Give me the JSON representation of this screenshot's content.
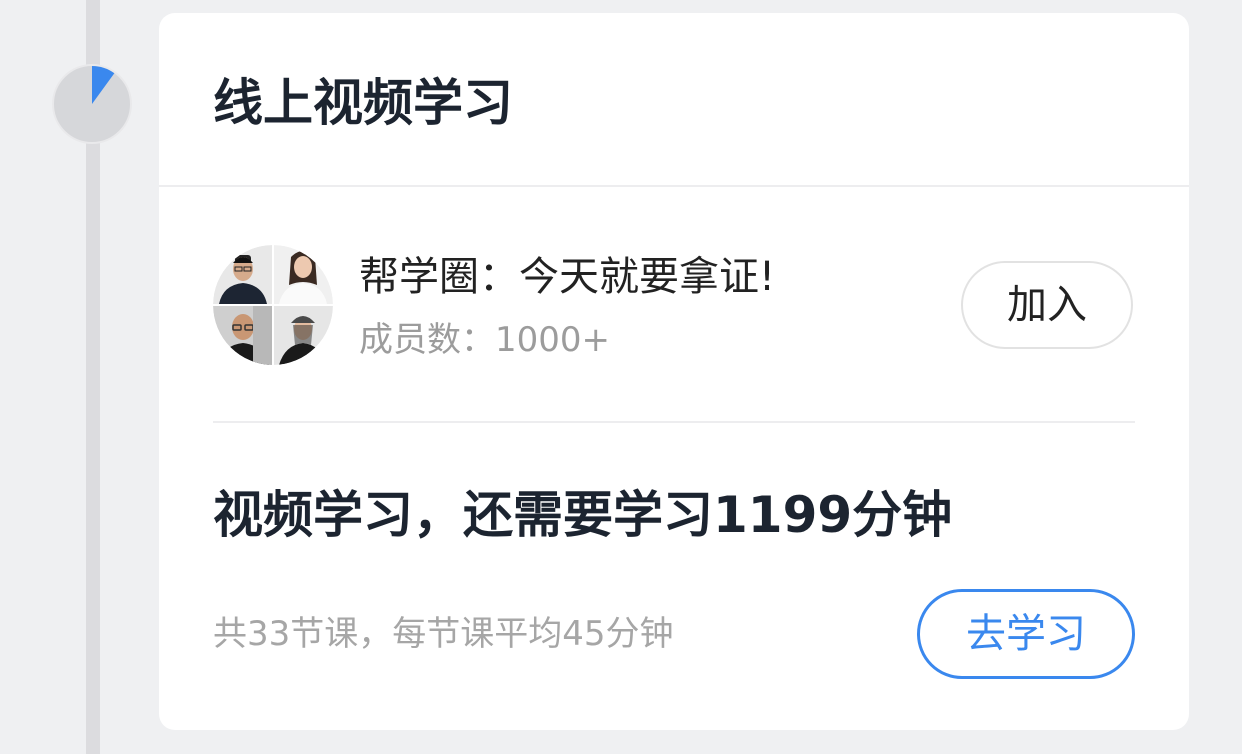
{
  "section": {
    "title": "线上视频学习",
    "progress": 0.1,
    "progress_color": "#3a88ee"
  },
  "group": {
    "name": "帮学圈：今天就要拿证!",
    "members": "成员数：1000+",
    "join_label": "加入"
  },
  "study": {
    "headline": "视频学习，还需要学习1199分钟",
    "course_info": "共33节课，每节课平均45分钟",
    "button_label": "去学习"
  },
  "colors": {
    "accent": "#3a88ee",
    "title_text": "#1c2430",
    "muted_text": "#9c9c9c",
    "background": "#eff0f2"
  }
}
